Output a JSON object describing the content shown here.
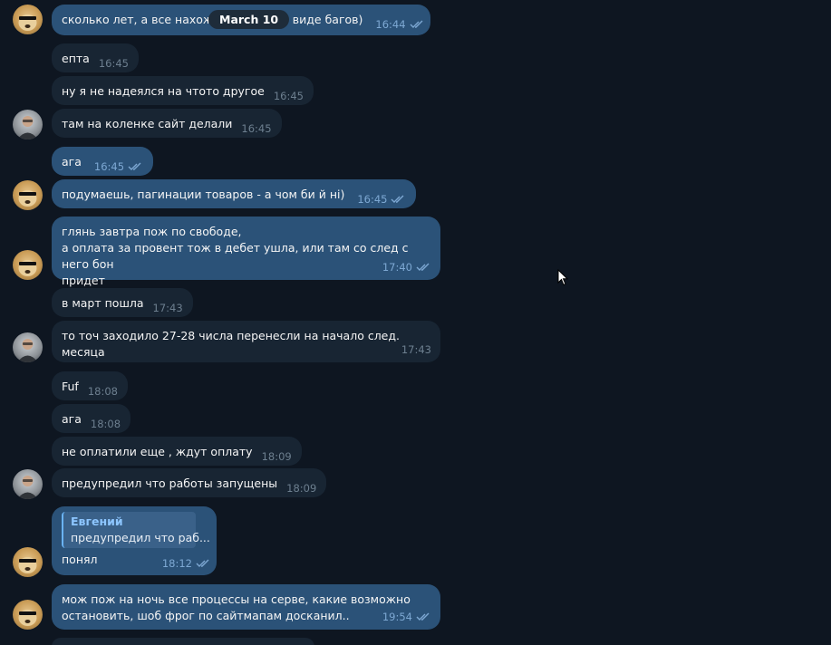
{
  "date_label": "March 10",
  "messages": [
    {
      "text": "сколько лет, а все нахожу ",
      "text_after": "(в виде багов)",
      "time": "16:44",
      "read": true
    },
    {
      "text": "епта",
      "time": "16:45"
    },
    {
      "text": "ну я не надеялся на чтото другое",
      "time": "16:45"
    },
    {
      "text": "там на коленке сайт делали",
      "time": "16:45"
    },
    {
      "text": "ага",
      "time": "16:45",
      "read": true
    },
    {
      "text": "подумаешь, пагинации товаров - а чом би й ні)",
      "time": "16:45",
      "read": true
    },
    {
      "text": "глянь завтра пож по свободе,\nа оплата за провент тож в дебет ушла, или там со след с него бон\nпридет",
      "time": "17:40",
      "read": true
    },
    {
      "text": "в март пошла",
      "time": "17:43"
    },
    {
      "text": "то точ заходило 27-28 числа перенесли на начало след. месяца",
      "time": "17:43"
    },
    {
      "text": "Fuf",
      "time": "18:08"
    },
    {
      "text": "ага",
      "time": "18:08"
    },
    {
      "text": "не оплатили еще , ждут оплату",
      "time": "18:09"
    },
    {
      "text": "предупредил что работы запущены",
      "time": "18:09"
    },
    {
      "reply_name": "Евгений",
      "reply_text": "предупредил что раб...",
      "text": "понял",
      "time": "18:12",
      "read": true
    },
    {
      "text": "мож пож на ночь все процессы на серве, какие возможно\nостановить, шоб фрог по сайтмапам досканил..",
      "time": "19:54",
      "read": true
    }
  ],
  "icons": {
    "read": "double-check-icon",
    "doge_avatar": "doge-avatar",
    "person_avatar": "person-avatar",
    "cursor": "mouse-cursor-icon"
  },
  "colors": {
    "background": "#0e1621",
    "incoming": "#182533",
    "outgoing": "#2b5278",
    "accent": "#6ab3f3"
  }
}
